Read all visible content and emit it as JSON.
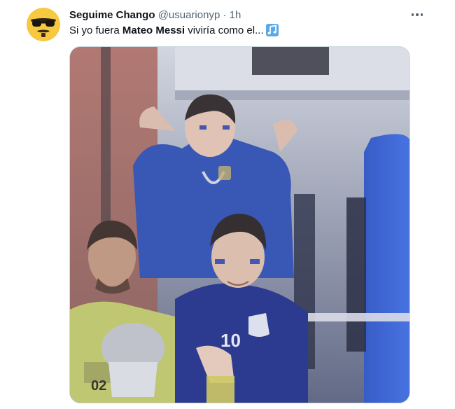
{
  "tweet": {
    "author_name": "Seguime Chango",
    "author_handle": "@usuarionyp",
    "separator": "·",
    "timestamp": "1h",
    "text_before": "Si yo fuera ",
    "text_bold": "Mateo Messi",
    "text_after": " viviría como el...",
    "emoji_icon": "musical-notes-icon"
  },
  "media": {
    "description_icon": "photo",
    "jersey_number": "10",
    "vest_number": "02"
  },
  "colors": {
    "text_primary": "#0f1419",
    "text_secondary": "#536471",
    "accent": "#1d9bf0",
    "border": "#cfd9de"
  }
}
